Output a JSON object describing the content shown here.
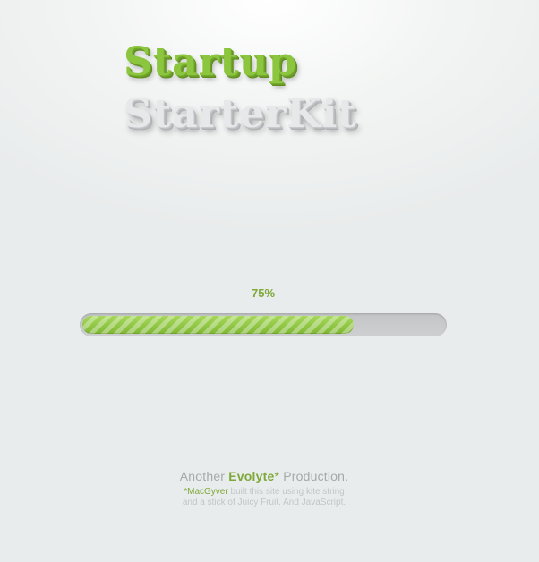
{
  "logo": {
    "line1": "Startup",
    "line2": "StarterKit"
  },
  "progress": {
    "label": "75%",
    "value": 0.75
  },
  "footer": {
    "prefix": "Another ",
    "brand": "Evolyte",
    "asterisk": "*",
    "suffix": " Production.",
    "credit_name": "*MacGyver",
    "credit_text": " built this site using kite string",
    "credit_line2": "and a stick of Juicy Fruit. And JavaScript."
  },
  "colors": {
    "accent": "#8cc63f",
    "logo_secondary": "#e6e8e9",
    "track": "#c8cacb",
    "background": "#e9ecec"
  }
}
